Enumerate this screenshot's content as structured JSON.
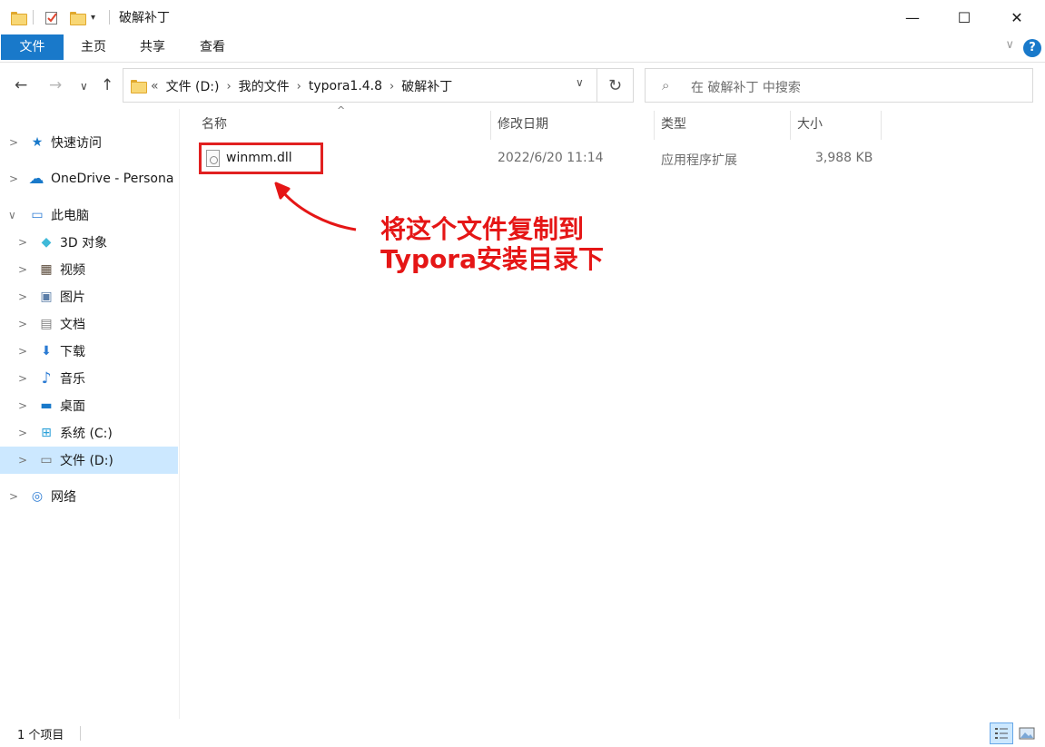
{
  "window": {
    "title": "破解补丁",
    "minimize_glyph": "—",
    "maximize_glyph": "☐",
    "close_glyph": "✕"
  },
  "ribbon": {
    "tabs": [
      "文件",
      "主页",
      "共享",
      "查看"
    ],
    "help_glyph": "?",
    "expand_glyph": "∨"
  },
  "navigation": {
    "back_glyph": "←",
    "forward_glyph": "→",
    "recent_glyph": "∨",
    "up_glyph": "↑",
    "breadcrumb_overflow": "«",
    "breadcrumbs": [
      "文件 (D:)",
      "我的文件",
      "typora1.4.8",
      "破解补丁"
    ],
    "crumb_separator": "›",
    "dropdown_glyph": "∨",
    "refresh_glyph": "↻",
    "search_placeholder": "在 破解补丁 中搜索",
    "search_icon_glyph": "⌕"
  },
  "sidebar": {
    "items": [
      {
        "label": "快速访问",
        "icon": "star-icon",
        "glyph": "★",
        "color": "#1979ca"
      },
      {
        "label": "OneDrive - Persona",
        "icon": "cloud-icon",
        "glyph": "☁",
        "color": "#1979ca"
      },
      {
        "label": "此电脑",
        "icon": "computer-icon",
        "glyph": "▭",
        "color": "#2b7bd3",
        "expanded": true
      },
      {
        "label": "3D 对象",
        "icon": "cube-icon",
        "glyph": "◆",
        "color": "#3fb9d8"
      },
      {
        "label": "视频",
        "icon": "film-icon",
        "glyph": "▦",
        "color": "#5a4a3a"
      },
      {
        "label": "图片",
        "icon": "picture-icon",
        "glyph": "▣",
        "color": "#5b7ea8"
      },
      {
        "label": "文档",
        "icon": "document-icon",
        "glyph": "▤",
        "color": "#7d7d7d"
      },
      {
        "label": "下载",
        "icon": "download-icon",
        "glyph": "⬇",
        "color": "#2b7bd3"
      },
      {
        "label": "音乐",
        "icon": "music-icon",
        "glyph": "♪",
        "color": "#2b7bd3"
      },
      {
        "label": "桌面",
        "icon": "desktop-icon",
        "glyph": "▬",
        "color": "#1979ca"
      },
      {
        "label": "系统 (C:)",
        "icon": "windows-drive-icon",
        "glyph": "⊞",
        "color": "#2aa0d8"
      },
      {
        "label": "文件 (D:)",
        "icon": "drive-icon",
        "glyph": "▭",
        "color": "#6d6d6d",
        "selected": true
      },
      {
        "label": "网络",
        "icon": "network-icon",
        "glyph": "◎",
        "color": "#2b7bd3"
      }
    ]
  },
  "columns": [
    "名称",
    "修改日期",
    "类型",
    "大小"
  ],
  "sort_glyph": "^",
  "files": [
    {
      "name": "winmm.dll",
      "modified": "2022/6/20 11:14",
      "type": "应用程序扩展",
      "size": "3,988 KB",
      "icon": "dll-file-icon"
    }
  ],
  "annotation": {
    "line1": "将这个文件复制到",
    "line2": "Typora安装目录下",
    "color": "#e51616"
  },
  "status": {
    "item_count": "1 个项目"
  },
  "colors": {
    "accent": "#1979ca",
    "selection": "#cce8ff",
    "highlight_box": "#e12020"
  }
}
